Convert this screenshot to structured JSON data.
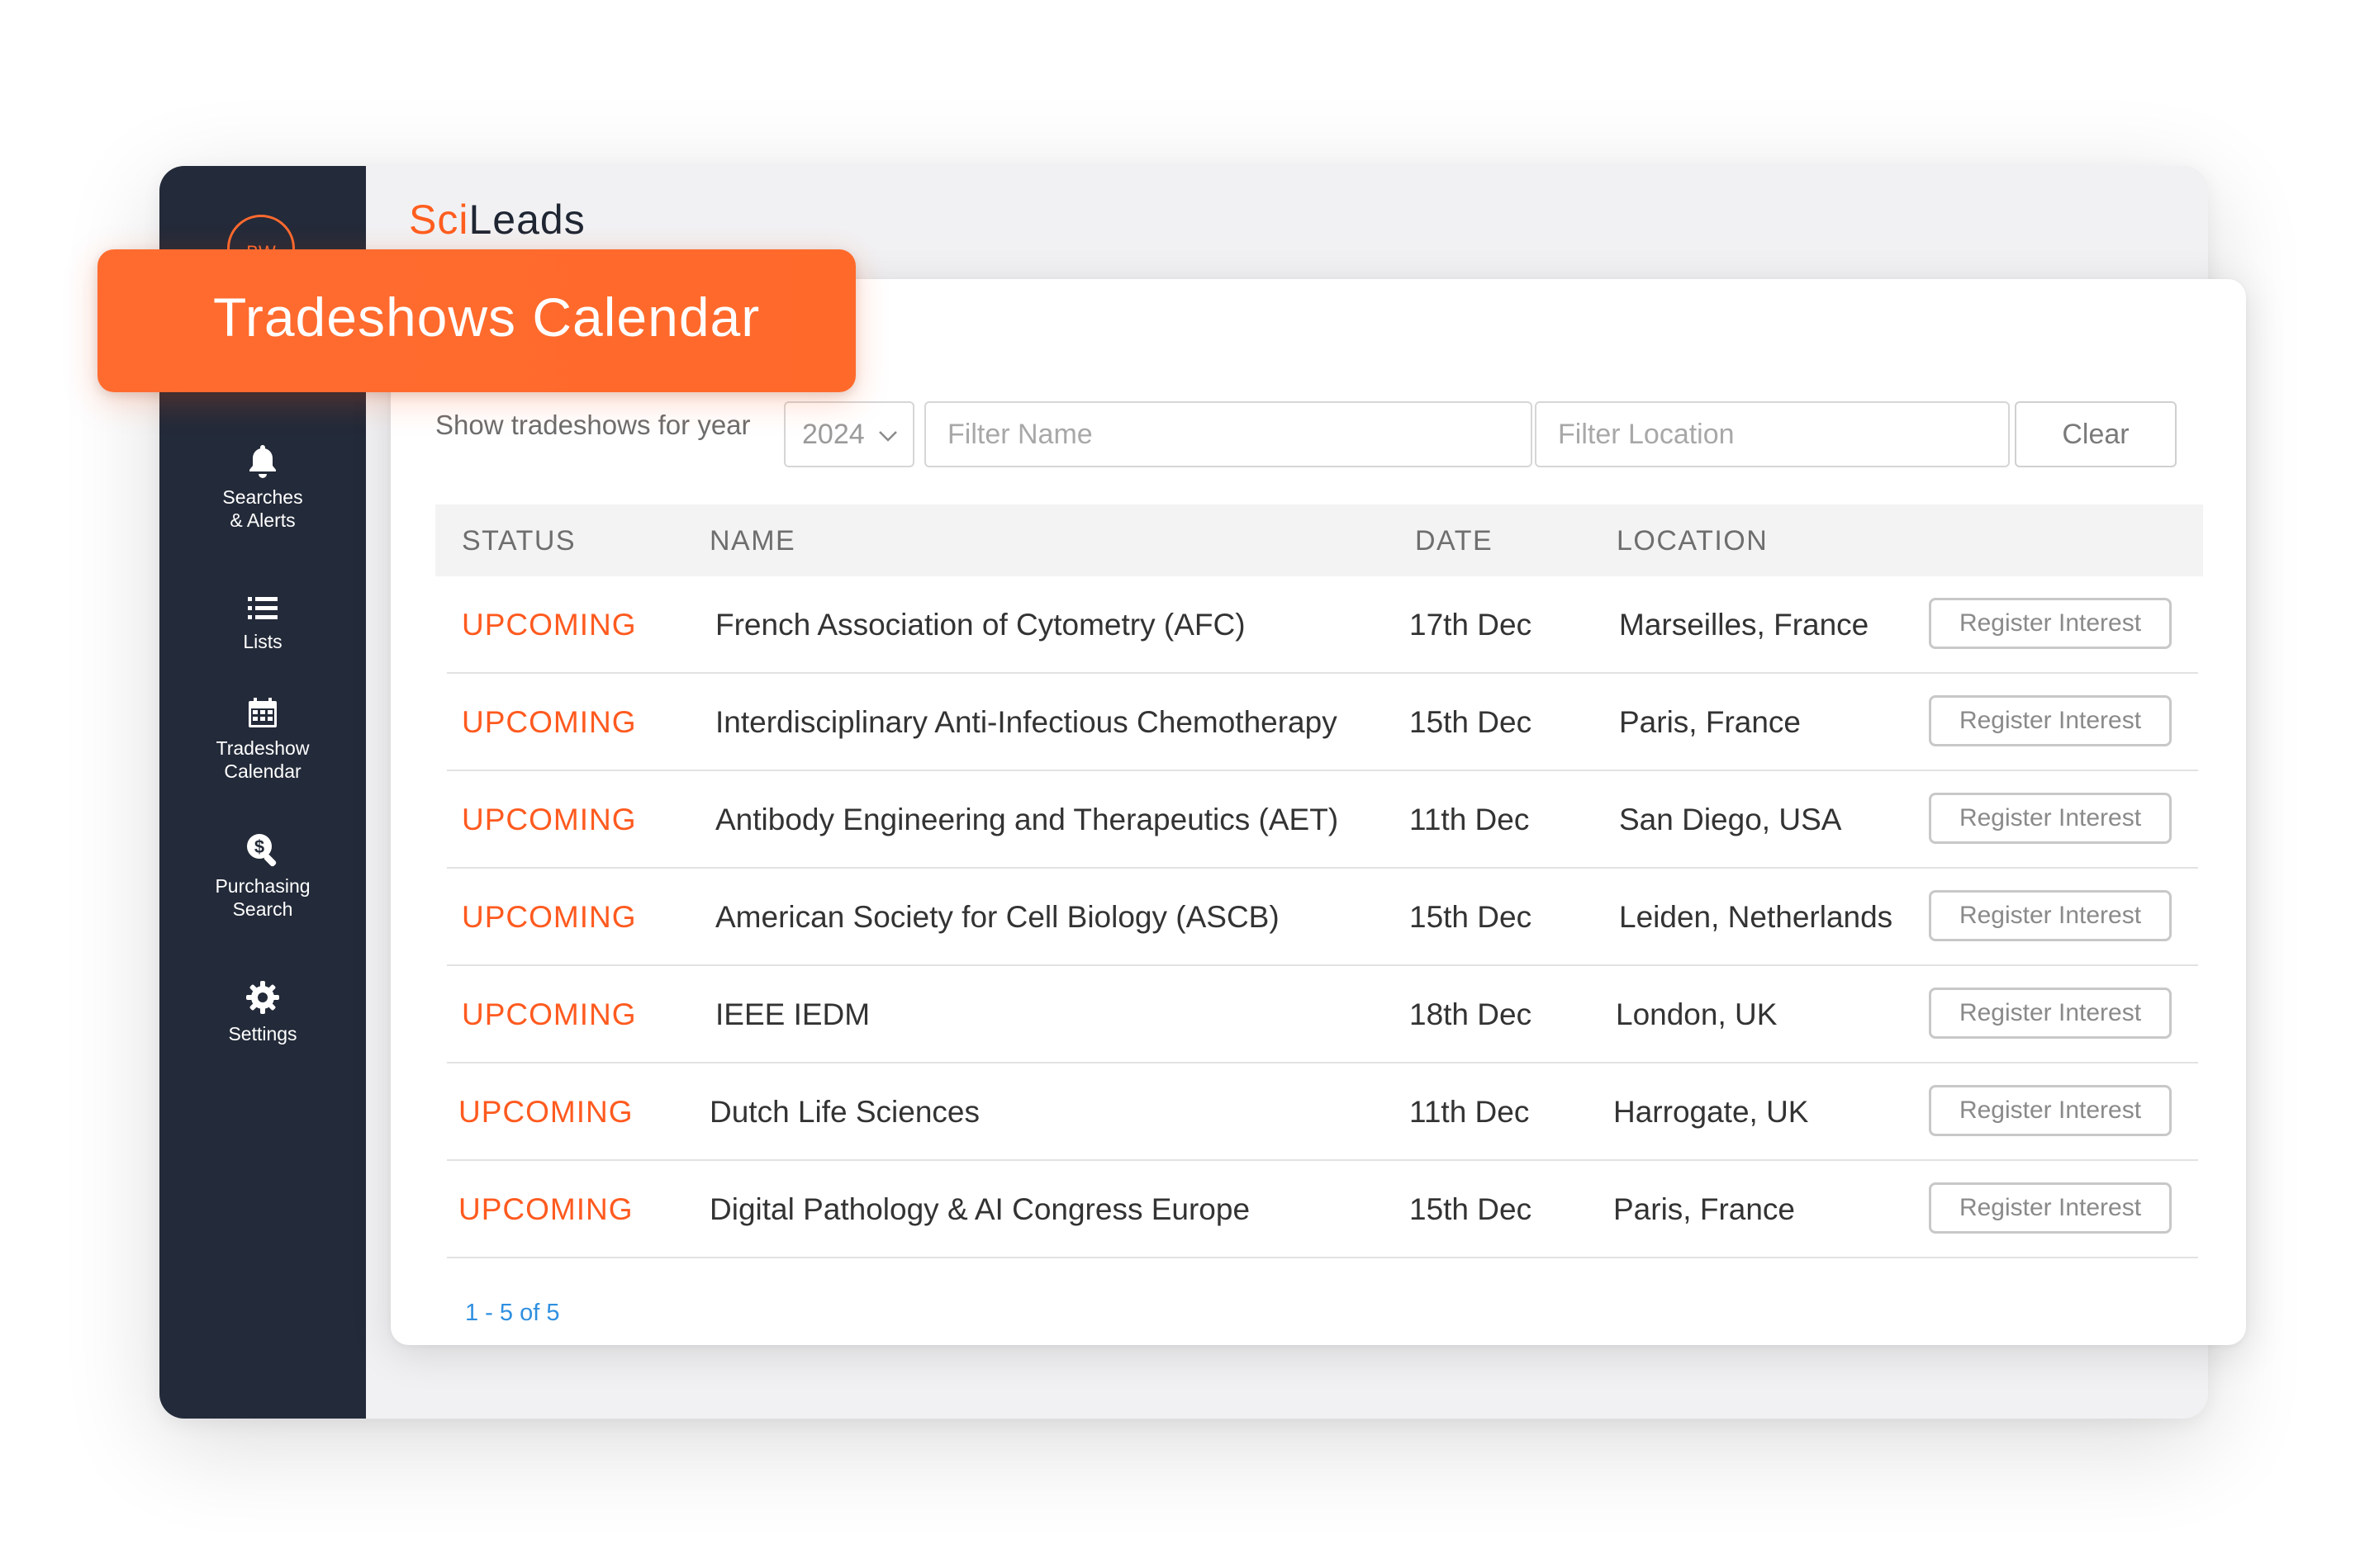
{
  "app": {
    "avatar_initials": "BW",
    "logo_part1": "Sci",
    "logo_part2": "Leads"
  },
  "banner": {
    "title": "Tradeshows Calendar"
  },
  "sidebar": {
    "items": [
      {
        "label": "Searches\n& Alerts",
        "icon": "bell-icon"
      },
      {
        "label": "Lists",
        "icon": "list-icon"
      },
      {
        "label": "Tradeshow\nCalendar",
        "icon": "calendar-icon"
      },
      {
        "label": "Purchasing\nSearch",
        "icon": "dollar-search-icon"
      },
      {
        "label": "Settings",
        "icon": "gear-icon"
      }
    ]
  },
  "filters": {
    "year_label": "Show tradeshows for year",
    "year_value": "2024",
    "name_placeholder": "Filter Name",
    "location_placeholder": "Filter Location",
    "clear_label": "Clear"
  },
  "table": {
    "headers": {
      "status": "STATUS",
      "name": "NAME",
      "date": "DATE",
      "location": "LOCATION"
    },
    "rows": [
      {
        "status": "UPCOMING",
        "name": "French Association of Cytometry (AFC)",
        "date": "17th Dec",
        "location": "Marseilles, France",
        "action": "Register Interest"
      },
      {
        "status": "UPCOMING",
        "name": "Interdisciplinary Anti-Infectious Chemotherapy",
        "date": "15th Dec",
        "location": "Paris, France",
        "action": "Register Interest"
      },
      {
        "status": "UPCOMING",
        "name": "Antibody Engineering and Therapeutics (AET)",
        "date": "11th Dec",
        "location": "San Diego, USA",
        "action": "Register Interest"
      },
      {
        "status": "UPCOMING",
        "name": "American Society for Cell Biology (ASCB)",
        "date": "15th Dec",
        "location": "Leiden, Netherlands",
        "action": "Register Interest"
      },
      {
        "status": "UPCOMING",
        "name": "IEEE IEDM",
        "date": "18th Dec",
        "location": "London, UK",
        "action": "Register Interest"
      },
      {
        "status": "UPCOMING",
        "name": "Dutch Life Sciences",
        "date": "11th Dec",
        "location": "Harrogate, UK",
        "action": "Register Interest"
      },
      {
        "status": "UPCOMING",
        "name": "Digital Pathology & AI Congress Europe",
        "date": "15th Dec",
        "location": "Paris, France",
        "action": "Register Interest"
      }
    ],
    "pagination": "1 - 5 of 5"
  },
  "colors": {
    "accent": "#ff6a2f",
    "sidebar": "#232a39",
    "link": "#2f8fe0"
  }
}
